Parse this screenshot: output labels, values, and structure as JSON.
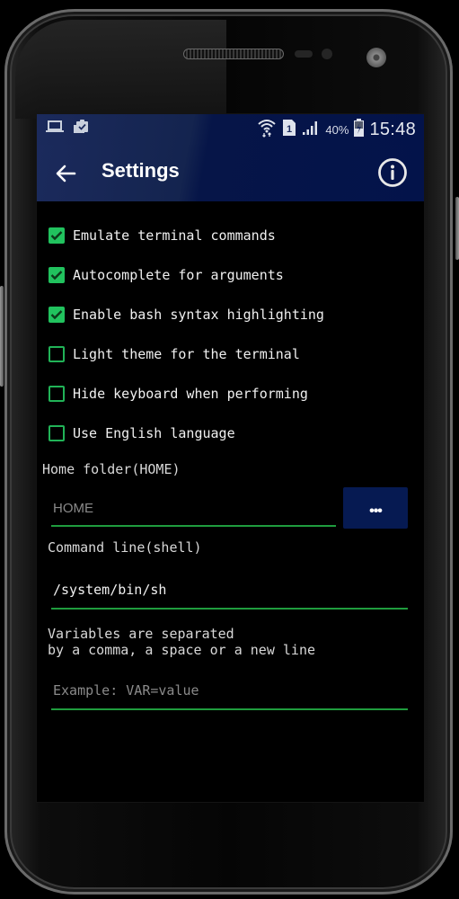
{
  "status_bar": {
    "left_icons": [
      "laptop-icon",
      "clipboard-check-icon"
    ],
    "right_icons": [
      "wifi-icon",
      "sim-1-icon",
      "signal-icon"
    ],
    "battery_percent": "40%",
    "battery_icon": "battery-charging-icon",
    "time": "15:48"
  },
  "app_bar": {
    "back_icon": "arrow-left-icon",
    "title": "Settings",
    "info_icon": "info-circle-icon"
  },
  "settings": {
    "checkboxes": [
      {
        "label": "Emulate terminal commands",
        "checked": true
      },
      {
        "label": "Autocomplete for arguments",
        "checked": true
      },
      {
        "label": "Enable bash syntax highlighting",
        "checked": true
      },
      {
        "label": "Light theme for the terminal",
        "checked": false
      },
      {
        "label": "Hide keyboard when performing",
        "checked": false
      },
      {
        "label": "Use English language",
        "checked": false
      }
    ],
    "home_folder": {
      "label": "Home folder(HOME)",
      "value": "",
      "placeholder": "HOME",
      "browse_button_label": "•••"
    },
    "shell": {
      "label": "Command line(shell)",
      "value": "/system/bin/sh",
      "placeholder": ""
    },
    "variables": {
      "hint": "Variables are separated\nby a comma, a space or a new line",
      "value": "",
      "placeholder": "Example: VAR=value"
    }
  },
  "colors": {
    "accent_green": "#21c25e",
    "app_bar_blue": "#03134a",
    "background": "#000000"
  }
}
